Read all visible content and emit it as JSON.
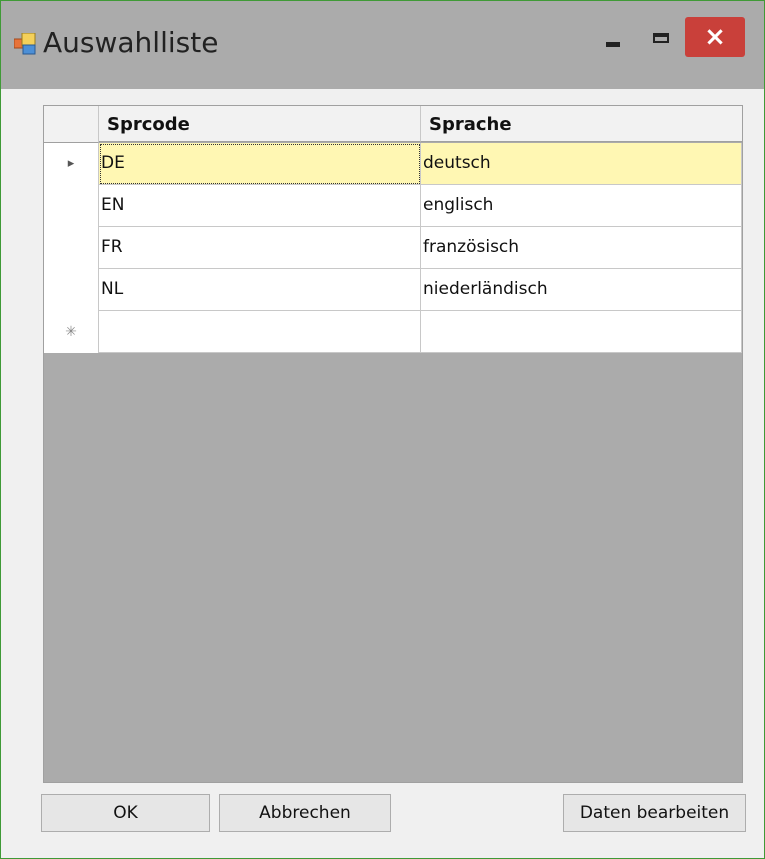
{
  "window": {
    "title": "Auswahlliste"
  },
  "titlebar_buttons": {
    "minimize": "minimize-icon",
    "maximize": "maximize-icon",
    "close": "×"
  },
  "grid": {
    "columns": [
      "Sprcode",
      "Sprache"
    ],
    "rows": [
      {
        "marker": "▸",
        "values": [
          "DE",
          "deutsch"
        ],
        "selected": true
      },
      {
        "marker": "",
        "values": [
          "EN",
          "englisch"
        ],
        "selected": false
      },
      {
        "marker": "",
        "values": [
          "FR",
          "französisch"
        ],
        "selected": false
      },
      {
        "marker": "",
        "values": [
          "NL",
          "niederländisch"
        ],
        "selected": false
      },
      {
        "marker": "✳",
        "values": [
          "",
          ""
        ],
        "selected": false
      }
    ],
    "colors": {
      "selected_row": "#fff7b3",
      "background": "#ababab"
    }
  },
  "buttons": {
    "ok": "OK",
    "cancel": "Abbrechen",
    "edit": "Daten bearbeiten"
  },
  "colors": {
    "close_button": "#c9403a",
    "titlebar": "#ababab",
    "window_border": "#3f9a36"
  }
}
